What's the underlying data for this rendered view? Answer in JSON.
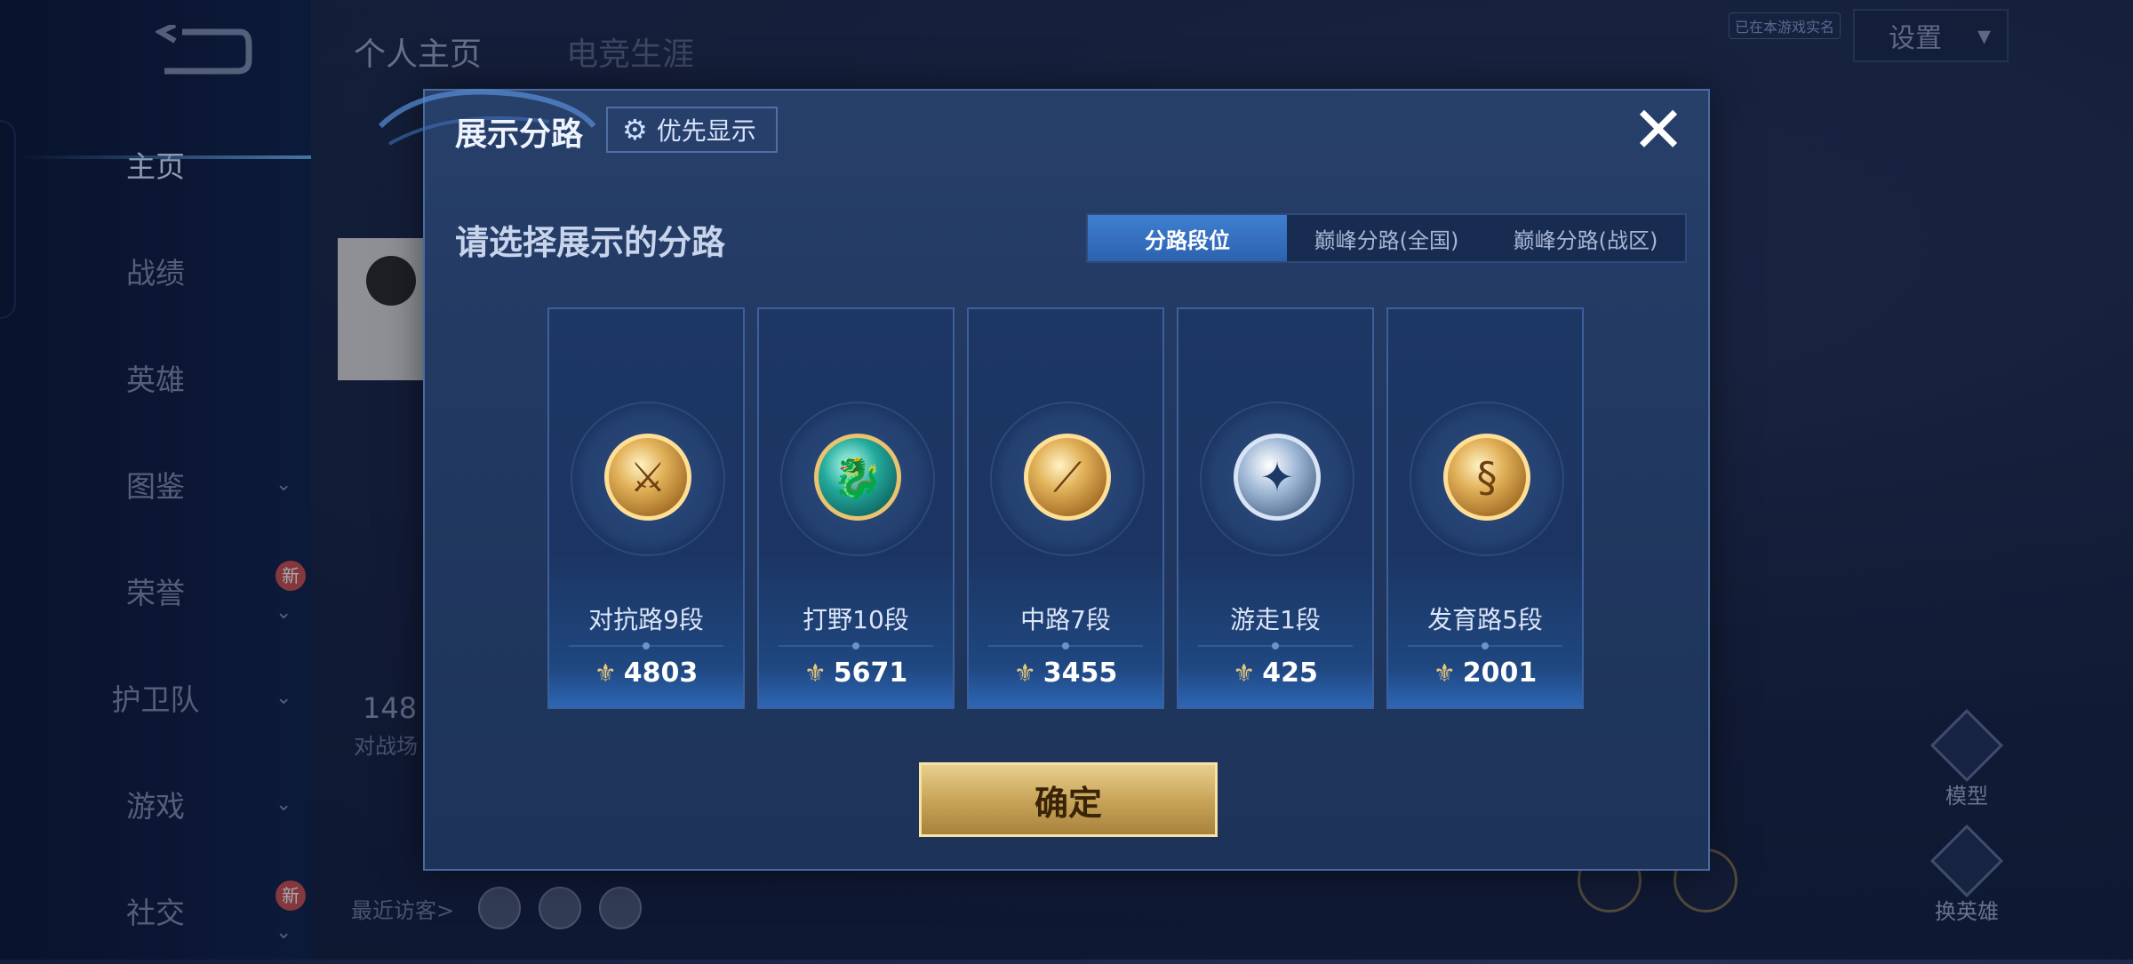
{
  "sidebar": {
    "items": [
      {
        "label": "主页",
        "active": true,
        "chevron": false,
        "badge": ""
      },
      {
        "label": "战绩",
        "active": false,
        "chevron": false,
        "badge": ""
      },
      {
        "label": "英雄",
        "active": false,
        "chevron": false,
        "badge": ""
      },
      {
        "label": "图鉴",
        "active": false,
        "chevron": true,
        "badge": ""
      },
      {
        "label": "荣誉",
        "active": false,
        "chevron": true,
        "badge": "新"
      },
      {
        "label": "护卫队",
        "active": false,
        "chevron": true,
        "badge": ""
      },
      {
        "label": "游戏",
        "active": false,
        "chevron": true,
        "badge": ""
      },
      {
        "label": "社交",
        "active": false,
        "chevron": true,
        "badge": "新"
      }
    ]
  },
  "header": {
    "tabs": [
      "个人主页",
      "电竞生涯"
    ],
    "settings_label": "设置",
    "tag": "已在本游戏实名"
  },
  "profile": {
    "stat_value": "148",
    "stat_label": "对战场",
    "visitors_label": "最近访客>"
  },
  "right_buttons": [
    "模型",
    "换英雄"
  ],
  "modal": {
    "title": "展示分路",
    "priority_label": "优先显示",
    "close_symbol": "✕",
    "subtitle": "请选择展示的分路",
    "segments": [
      "分路段位",
      "巅峰分路(全国)",
      "巅峰分路(战区)"
    ],
    "selected_segment": "分路段位",
    "cards": [
      {
        "label": "对抗路9段",
        "score": "4803",
        "medal": "gold",
        "emblem": "crossed-swords-icon",
        "glyph": "⚔"
      },
      {
        "label": "打野10段",
        "score": "5671",
        "medal": "teal",
        "emblem": "dragon-icon",
        "glyph": "🐉"
      },
      {
        "label": "中路7段",
        "score": "3455",
        "medal": "gold",
        "emblem": "wand-icon",
        "glyph": "⟋"
      },
      {
        "label": "游走1段",
        "score": "425",
        "medal": "silver",
        "emblem": "wings-icon",
        "glyph": "✦"
      },
      {
        "label": "发育路5段",
        "score": "2001",
        "medal": "gold",
        "emblem": "bow-icon",
        "glyph": "§"
      }
    ],
    "confirm_label": "确定"
  },
  "colors": {
    "accent_blue": "#3f7fd0",
    "gold_button": "#c9a55a",
    "modal_bg": "#213860"
  }
}
